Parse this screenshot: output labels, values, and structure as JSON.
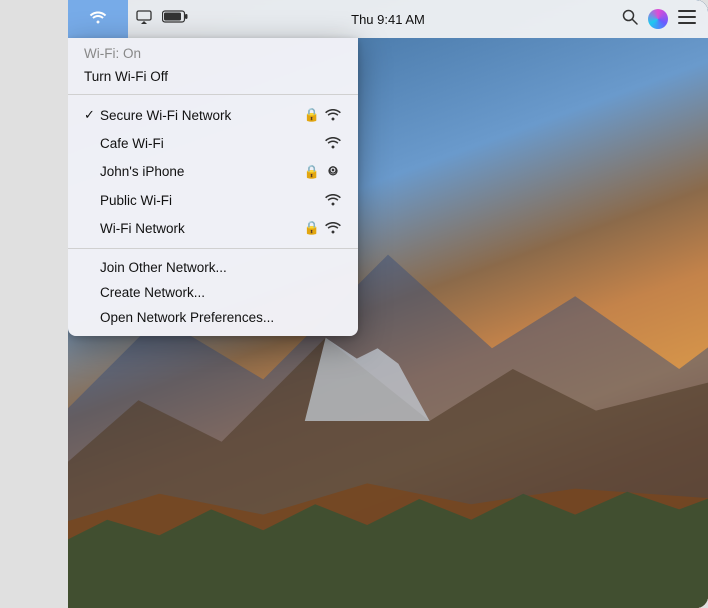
{
  "screen": {
    "background": "macOS wallpaper - mountains"
  },
  "menubar": {
    "time": "Thu 9:41 AM",
    "wifi_status": "active",
    "icons": [
      "wifi",
      "airplay",
      "battery",
      "time",
      "search",
      "siri",
      "menu"
    ]
  },
  "wifi_menu": {
    "header": "Wi-Fi: On",
    "turn_off_label": "Turn Wi-Fi Off",
    "networks": [
      {
        "name": "Secure Wi-Fi Network",
        "checked": true,
        "lock": true,
        "signal": "full",
        "type": "wifi"
      },
      {
        "name": "Cafe Wi-Fi",
        "checked": false,
        "lock": false,
        "signal": "full",
        "type": "wifi"
      },
      {
        "name": "John's iPhone",
        "checked": false,
        "lock": true,
        "signal": "full",
        "type": "hotspot"
      },
      {
        "name": "Public Wi-Fi",
        "checked": false,
        "lock": false,
        "signal": "full",
        "type": "wifi"
      },
      {
        "name": "Wi-Fi Network",
        "checked": false,
        "lock": true,
        "signal": "full",
        "type": "wifi"
      }
    ],
    "actions": [
      "Join Other Network...",
      "Create Network...",
      "Open Network Preferences..."
    ]
  }
}
